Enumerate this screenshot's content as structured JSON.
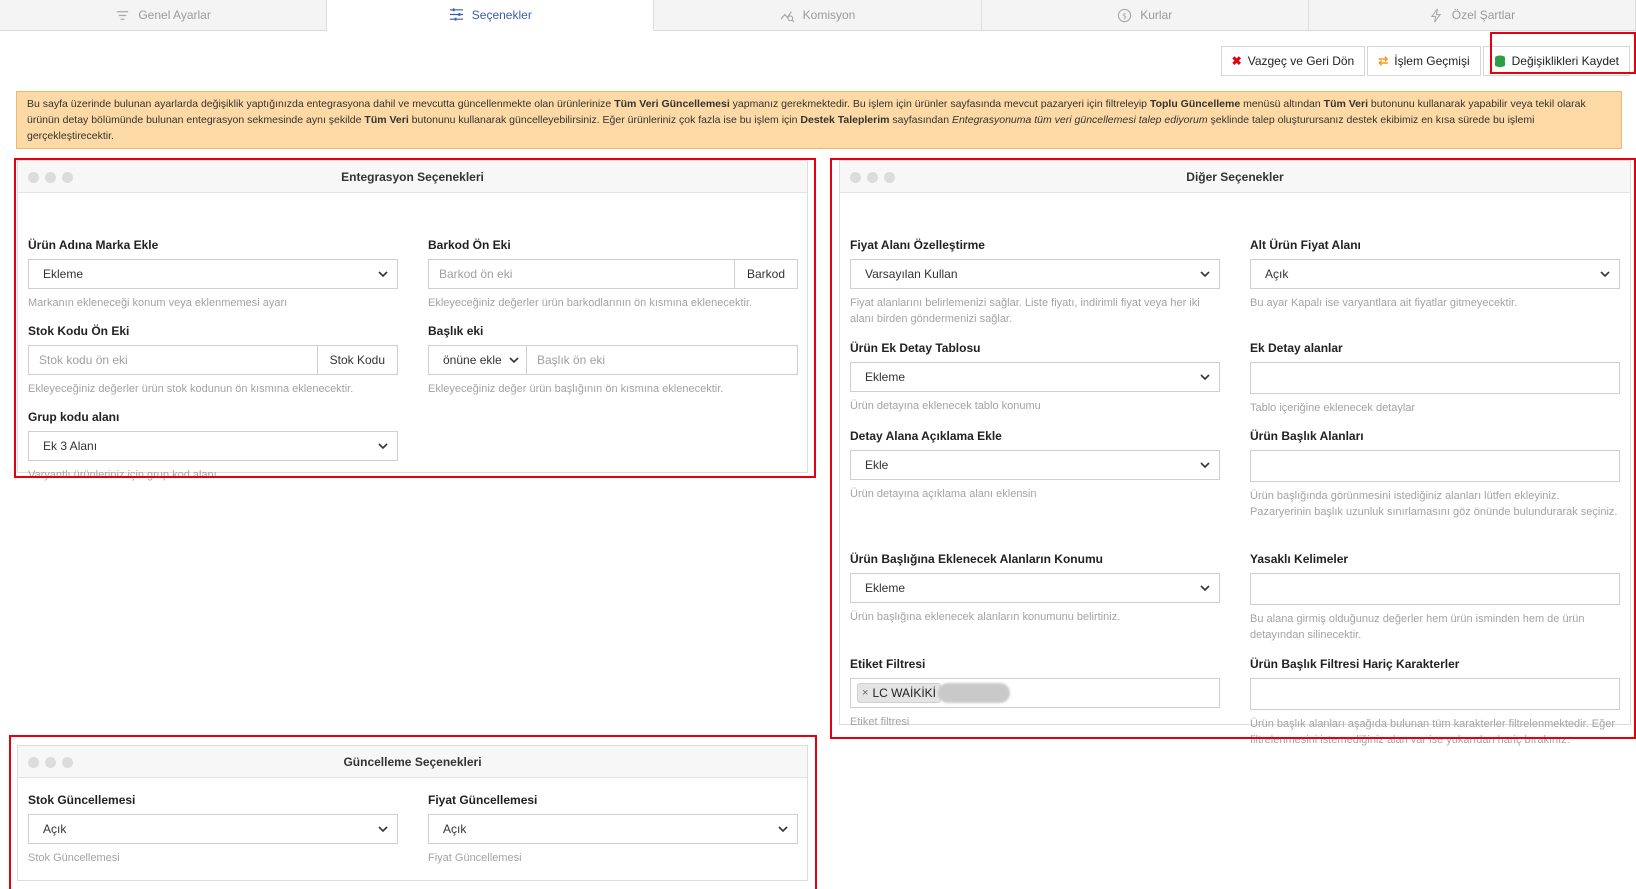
{
  "tabs": [
    {
      "label": "Genel Ayarlar",
      "icon": "filter-lines-icon"
    },
    {
      "label": "Seçenekler",
      "icon": "sliders-icon",
      "active": true
    },
    {
      "label": "Komisyon",
      "icon": "chart-search-icon"
    },
    {
      "label": "Kurlar",
      "icon": "currency-exchange-icon"
    },
    {
      "label": "Özel Şartlar",
      "icon": "lightning-icon"
    }
  ],
  "toolbar": {
    "cancel_label": "Vazgeç ve Geri Dön",
    "history_label": "İşlem Geçmişi",
    "save_label": "Değişiklikleri Kaydet"
  },
  "alert": {
    "t1": "Bu sayfa üzerinde bulunan ayarlarda değişiklik yaptığınızda entegrasyona dahil ve mevcutta güncellenmekte olan ürünlerinize ",
    "b1": "Tüm Veri Güncellemesi",
    "t2": " yapmanız gerekmektedir. Bu işlem için ürünler sayfasında mevcut pazaryeri için filtreleyip ",
    "b2": "Toplu Güncelleme",
    "t3": " menüsü altından ",
    "b3": "Tüm Veri",
    "t4": " butonunu kullanarak yapabilir veya tekil olarak ürünün detay bölümünde bulunan entegrasyon sekmesinde aynı şekilde ",
    "b4": "Tüm Veri",
    "t5": " butonunu kullanarak güncelleyebilirsiniz. Eğer ürünleriniz çok fazla ise bu işlem için ",
    "b5": "Destek Taleplerim",
    "t6": " sayfasından ",
    "i1": "Entegrasyonuma tüm veri güncellemesi talep ediyorum",
    "t7": " şeklinde talep oluşturursanız destek ekibimiz en kısa sürede bu işlemi gerçekleştirecektir."
  },
  "entegrasyon": {
    "title": "Entegrasyon Seçenekleri",
    "marka": {
      "label": "Ürün Adına Marka Ekle",
      "value": "Ekleme",
      "help": "Markanın ekleneceği konum veya eklenmemesi ayarı"
    },
    "barkod": {
      "label": "Barkod Ön Eki",
      "placeholder": "Barkod ön eki",
      "addon": "Barkod",
      "help": "Ekleyeceğiniz değerler ürün barkodlarının ön kısmına eklenecektir."
    },
    "stok": {
      "label": "Stok Kodu Ön Eki",
      "placeholder": "Stok kodu ön eki",
      "addon": "Stok Kodu",
      "help": "Ekleyeceğiniz değerler ürün stok kodunun ön kısmına eklenecektir."
    },
    "baslik": {
      "label": "Başlık eki",
      "select": "önüne ekle",
      "placeholder": "Başlık ön eki",
      "help": "Ekleyeceğiniz değer ürün başlığının ön kısmına eklenecektir."
    },
    "grup": {
      "label": "Grup kodu alanı",
      "value": "Ek 3 Alanı",
      "help": "Varyantlı ürünleriniz için grup kod alanı"
    }
  },
  "diger": {
    "title": "Diğer Seçenekler",
    "fiyat_alani": {
      "label": "Fiyat Alanı Özelleştirme",
      "value": "Varsayılan Kullan",
      "help": "Fiyat alanlarını belirlemenizi sağlar. Liste fiyatı, indirimli fiyat veya her iki alanı birden göndermenizi sağlar."
    },
    "alt_urun": {
      "label": "Alt Ürün Fiyat Alanı",
      "value": "Açık",
      "help": "Bu ayar Kapalı ise varyantlara ait fiyatlar gitmeyecektir."
    },
    "ek_detay_tablo": {
      "label": "Ürün Ek Detay Tablosu",
      "value": "Ekleme",
      "help": "Ürün detayına eklenecek tablo konumu"
    },
    "ek_detay_alan": {
      "label": "Ek Detay alanlar",
      "value": "",
      "help": "Tablo içeriğine eklenecek detaylar"
    },
    "aciklama": {
      "label": "Detay Alana Açıklama Ekle",
      "value": "Ekle",
      "help": "Ürün detayına açıklama alanı eklensin"
    },
    "baslik_alan": {
      "label": "Ürün Başlık Alanları",
      "value": "",
      "help": "Ürün başlığında görünmesini istediğiniz alanları lütfen ekleyiniz. Pazaryerinin başlık uzunluk sınırlamasını göz önünde bulundurarak seçiniz."
    },
    "baslik_konum": {
      "label": "Ürün Başlığına Eklenecek Alanların Konumu",
      "value": "Ekleme",
      "help": "Ürün başlığına eklenecek alanların konumunu belirtiniz."
    },
    "yasakli": {
      "label": "Yasaklı Kelimeler",
      "value": "",
      "help": "Bu alana girmiş olduğunuz değerler hem ürün isminden hem de ürün detayından silinecektir."
    },
    "etiket": {
      "label": "Etiket Filtresi",
      "tag": "LC WAİKİKİ",
      "help": "Etiket filtresi"
    },
    "haric": {
      "label": "Ürün Başlık Filtresi Hariç Karakterler",
      "value": "",
      "help": "Ürün başlık alanları aşağıda bulunan tüm karakterler filtrelenmektedir. Eğer filtrelenmesini istemediğiniz alan var ise yukarıdan hariç bırakınız."
    }
  },
  "guncelleme": {
    "title": "Güncelleme Seçenekleri",
    "stok": {
      "label": "Stok Güncellemesi",
      "value": "Açık",
      "help": "Stok Güncellemesi"
    },
    "fiyat": {
      "label": "Fiyat Güncellemesi",
      "value": "Açık",
      "help": "Fiyat Güncellemesi"
    }
  },
  "colors": {
    "highlight": "#e3000f",
    "alert_bg": "#fdd9a6",
    "active_tab": "#3b5ea8"
  }
}
